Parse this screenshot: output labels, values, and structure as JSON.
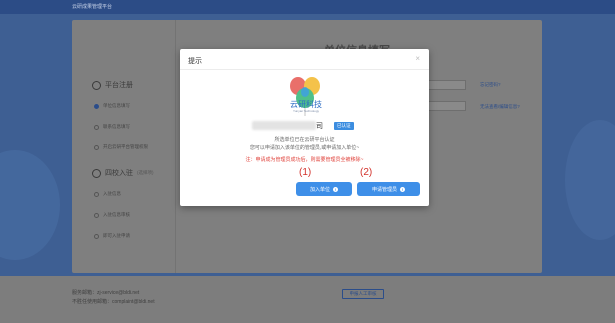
{
  "page": {
    "brand": "云研成果管理平台",
    "form_title": "单位信息填写"
  },
  "steps": {
    "main1": {
      "label": "平台注册"
    },
    "subs1": [
      "单位信息填写",
      "联系信息填写",
      "开启云研平台管理权限"
    ],
    "main2": {
      "label": "四校入驻",
      "note": "(选择项)"
    },
    "subs2": [
      "入驻信息",
      "入驻信息审核",
      "即可入驻申请"
    ]
  },
  "side_links": [
    "忘记密码?",
    "无法查看/编辑信息?"
  ],
  "footer": {
    "email1": "服务邮箱：zj-service@bldi.net",
    "email2": "不胜任使用邮箱：complaint@bldi.net",
    "manual_button": "申报人工审核"
  },
  "modal": {
    "title": "提示",
    "close": "×",
    "logo_cn": "云研科技",
    "logo_en": "Yunyan Technology",
    "org_suffix": "司",
    "verified_badge": "已认证",
    "info1": "所选单位已在云研平台认证",
    "info2": "您可以申请加入该单位的管理员,或申请加入单位~",
    "warning": "注：申请成为管理员成功后，则需要管理员全被移除~",
    "num1": "(1)",
    "num2": "(2)",
    "join_button": "加入单位",
    "admin_button": "申请管理员"
  },
  "colors": {
    "primary": "#3e8fe8",
    "warning": "#e0413a",
    "annotation": "#d2312b"
  }
}
